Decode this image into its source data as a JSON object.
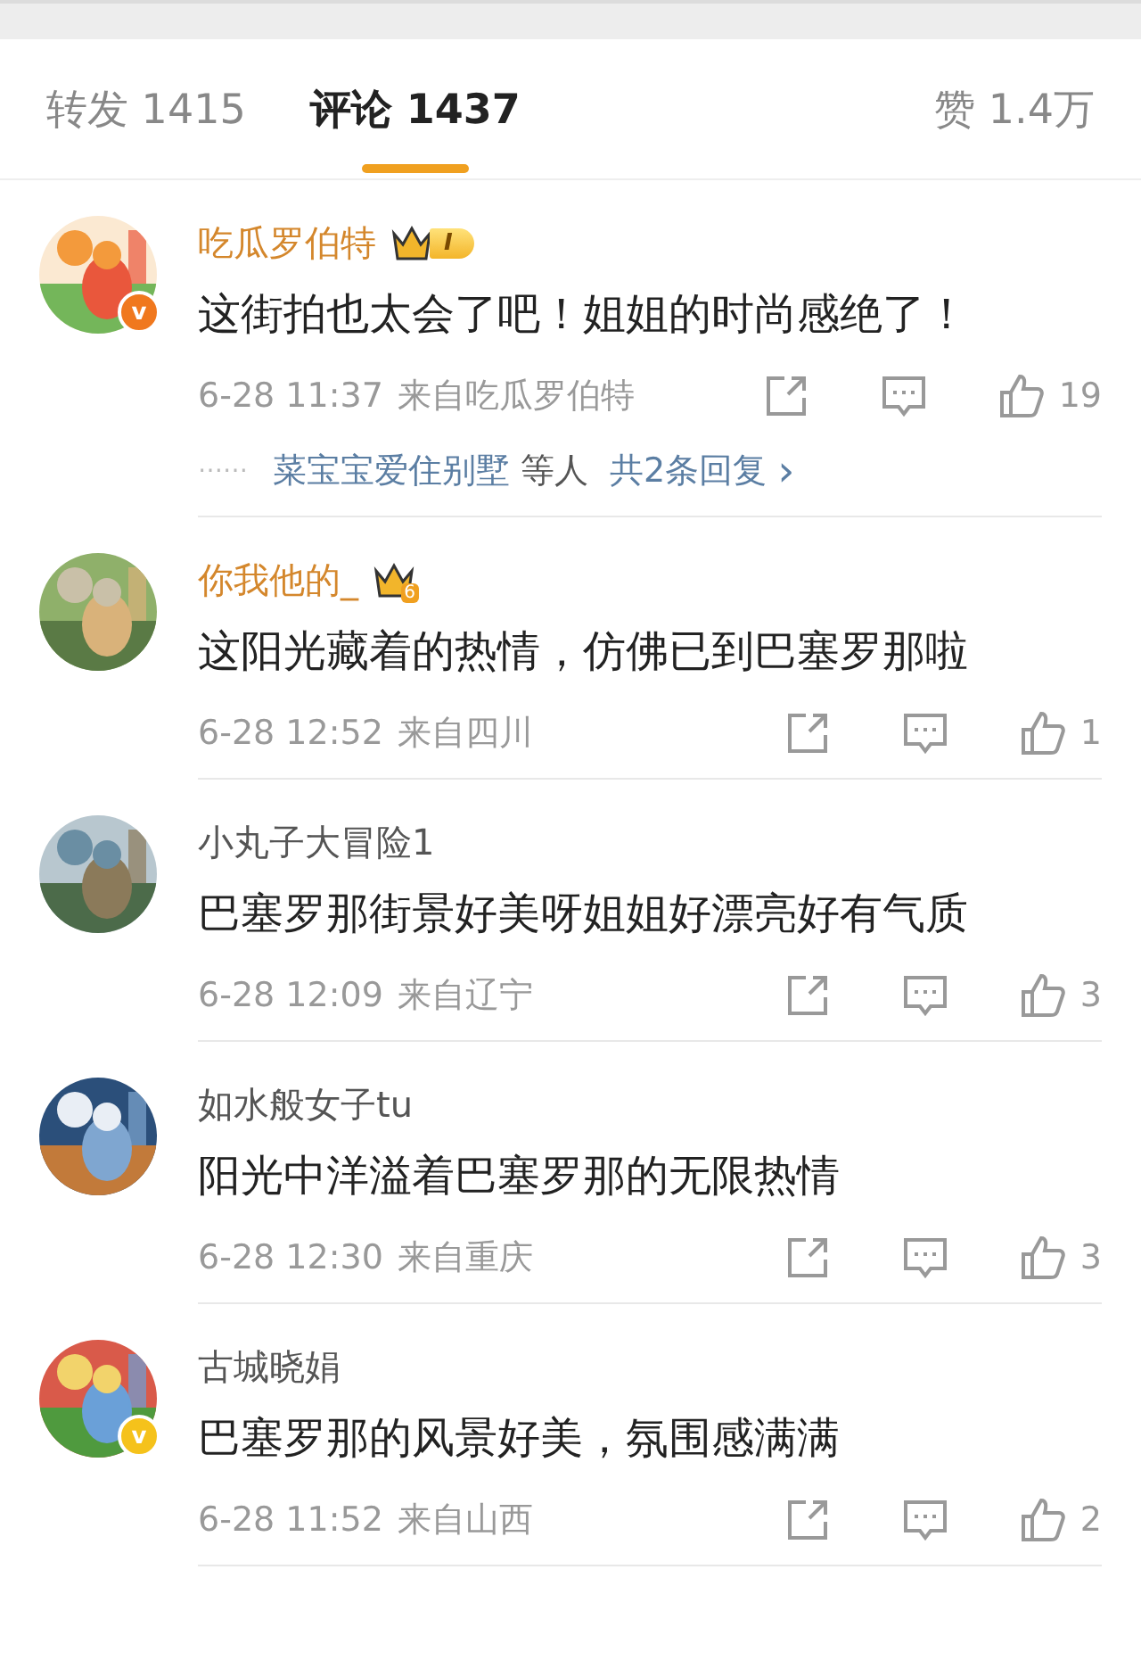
{
  "tabs": [
    {
      "label": "转发 1415",
      "selected": false,
      "kind": "main"
    },
    {
      "label": "评论 1437",
      "selected": true,
      "kind": "main"
    },
    {
      "label": "赞 1.4万",
      "selected": false,
      "kind": "aside"
    }
  ],
  "comments": [
    {
      "name": "吃瓜罗伯特",
      "vip": true,
      "badge": {
        "kind": "crown-level",
        "text": "I"
      },
      "verified": {
        "text": "v",
        "color": "#f0781e"
      },
      "text": "这街拍也太会了吧！姐姐的时尚感绝了！",
      "time": "6-28 11:37",
      "source": "来自吃瓜罗伯特",
      "likes": "19",
      "replies": {
        "dots": "⋯⋯",
        "names": "菜宝宝爱住别墅",
        "suffix": "等人",
        "count": "共2条回复",
        "chevron": "›"
      }
    },
    {
      "name": "你我他的_",
      "vip": true,
      "badge": {
        "kind": "crown",
        "text": "6"
      },
      "text": "这阳光藏着的热情，仿佛已到巴塞罗那啦",
      "time": "6-28 12:52",
      "source": "来自四川",
      "likes": "1"
    },
    {
      "name": "小丸子大冒险1",
      "vip": false,
      "text": "巴塞罗那街景好美呀姐姐好漂亮好有气质",
      "time": "6-28 12:09",
      "source": "来自辽宁",
      "likes": "3"
    },
    {
      "name": "如水般女子tu",
      "vip": false,
      "text": "阳光中洋溢着巴塞罗那的无限热情",
      "time": "6-28 12:30",
      "source": "来自重庆",
      "likes": "3"
    },
    {
      "name": "古城晓娟",
      "vip": false,
      "verified": {
        "text": "v",
        "color": "#f5c21b"
      },
      "text": "巴塞罗那的风景好美，氛围感满满",
      "time": "6-28 11:52",
      "source": "来自山西",
      "likes": "2"
    }
  ]
}
